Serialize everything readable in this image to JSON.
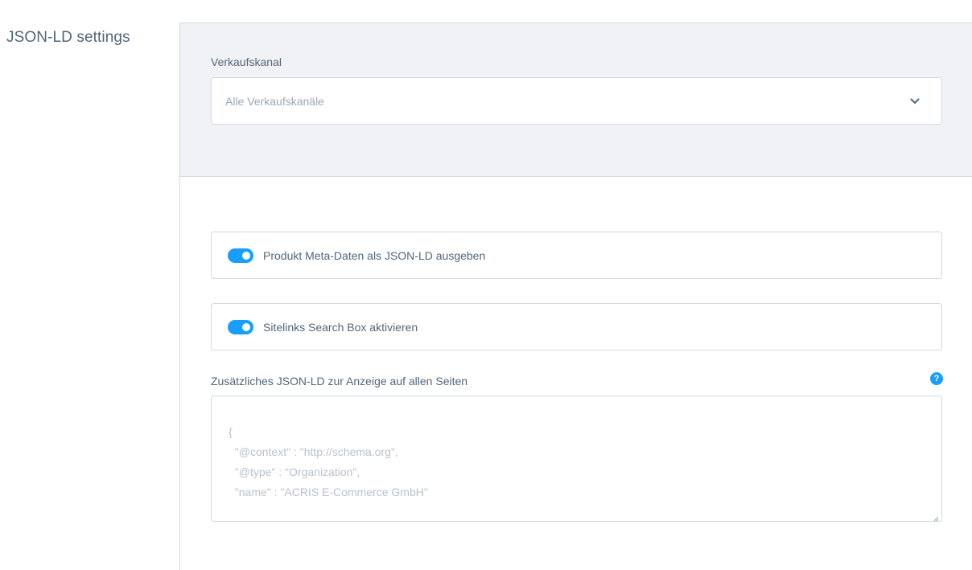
{
  "section": {
    "title": "JSON-LD settings"
  },
  "channel": {
    "label": "Verkaufskanal",
    "selected": "Alle Verkaufskanäle"
  },
  "switches": [
    {
      "label": "Produkt Meta-Daten als JSON-LD ausgeben",
      "on": true
    },
    {
      "label": "Sitelinks Search Box aktivieren",
      "on": true
    }
  ],
  "json_field": {
    "label": "Zusätzliches JSON-LD zur Anzeige auf allen Seiten",
    "help": "?",
    "placeholder": "{\n  \"@context\" : \"http://schema.org\",\n  \"@type\" : \"Organization\",\n  \"name\" : \"ACRIS E-Commerce GmbH\""
  },
  "colors": {
    "accent": "#189eff",
    "text": "#52667a",
    "border": "#d1d9e0",
    "header_bg": "#f0f2f5"
  }
}
